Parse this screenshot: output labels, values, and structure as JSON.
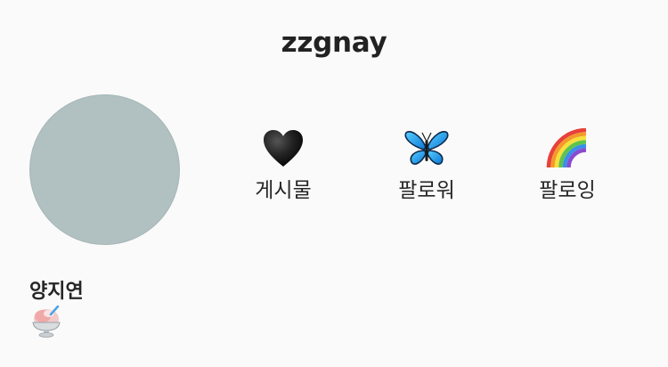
{
  "profile": {
    "username": "zzgnay",
    "display_name": "양지연",
    "bio_icon": "shaved-ice-icon",
    "avatar_color": "#b1c1c1"
  },
  "stats": [
    {
      "label": "게시물",
      "icon": "black-heart-icon"
    },
    {
      "label": "팔로워",
      "icon": "butterfly-icon"
    },
    {
      "label": "팔로잉",
      "icon": "rainbow-icon"
    }
  ]
}
